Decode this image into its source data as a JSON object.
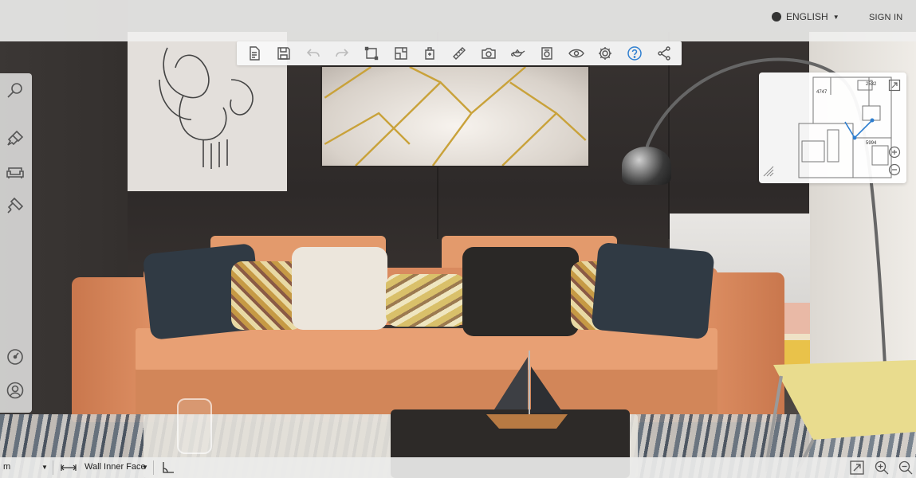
{
  "app": {
    "language_label": "ENGLISH",
    "signin_label": "SIGN IN"
  },
  "toolbar": {
    "items": [
      {
        "icon": "new-file-icon"
      },
      {
        "icon": "save-icon"
      },
      {
        "icon": "undo-icon"
      },
      {
        "icon": "redo-icon"
      },
      {
        "icon": "draw-room-icon"
      },
      {
        "icon": "floor-plan-icon"
      },
      {
        "icon": "auto-layout-icon"
      },
      {
        "icon": "ruler-icon"
      },
      {
        "icon": "camera-icon"
      },
      {
        "icon": "teapot-icon"
      },
      {
        "icon": "render-icon"
      },
      {
        "icon": "view-icon"
      },
      {
        "icon": "settings-icon"
      },
      {
        "icon": "help-icon"
      },
      {
        "icon": "share-icon"
      }
    ]
  },
  "leftbar": {
    "items": [
      {
        "icon": "search-icon"
      },
      {
        "icon": "brush-icon"
      },
      {
        "icon": "furniture-icon"
      },
      {
        "icon": "paint-roller-icon"
      },
      {
        "icon": "compass-icon"
      },
      {
        "icon": "user-icon"
      }
    ]
  },
  "minimap": {
    "dimension_1": "2532",
    "dimension_2": "4747",
    "dimension_3": "5994"
  },
  "bottombar": {
    "unit_value": "m",
    "measure_label": "Wall Inner Face"
  },
  "colors": {
    "accent_blue": "#2f7fd0",
    "toolbar_icon": "#555555"
  }
}
